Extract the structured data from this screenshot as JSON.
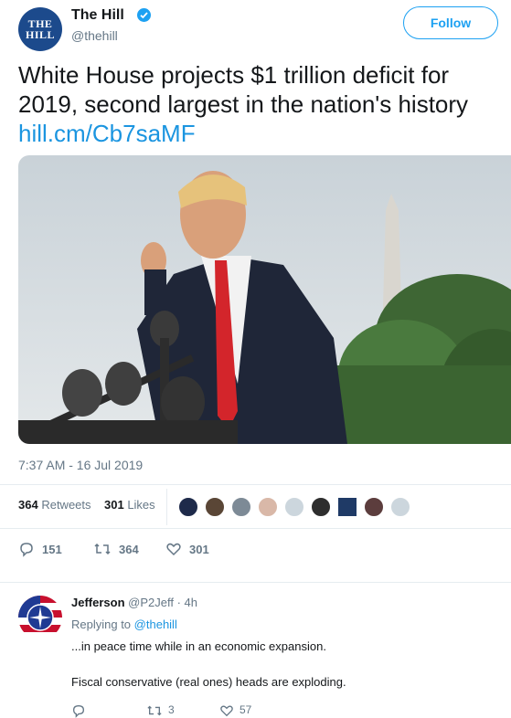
{
  "header": {
    "avatar_line1": "THE",
    "avatar_line2": "HILL",
    "name": "The Hill",
    "handle": "@thehill",
    "follow_label": "Follow"
  },
  "tweet": {
    "text": "White House projects $1 trillion deficit for 2019, second largest in the nation's history",
    "link": "hill.cm/Cb7saMF",
    "timestamp": "7:37 AM - 16 Jul 2019"
  },
  "stats": {
    "retweets_count": "364",
    "retweets_label": "Retweets",
    "likes_count": "301",
    "likes_label": "Likes"
  },
  "actions": {
    "replies": "151",
    "retweets": "364",
    "likes": "301"
  },
  "reply": {
    "name": "Jefferson",
    "handle": "@P2Jeff",
    "time": "· 4h",
    "replying_prefix": "Replying to",
    "replying_to": "@thehill",
    "line1": "...in peace time while in an economic expansion.",
    "line2": "Fiscal conservative (real ones) heads are exploding.",
    "retweets": "3",
    "likes": "57"
  },
  "colors": {
    "accent": "#1da1f2",
    "link": "#1b95e0",
    "muted": "#657786"
  }
}
